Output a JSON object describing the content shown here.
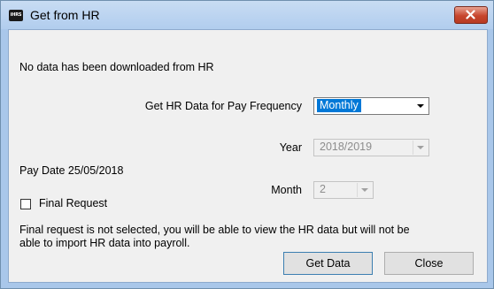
{
  "window": {
    "title": "Get from HR",
    "app_icon_text": "iHRS"
  },
  "status_message": "No data has been downloaded from HR",
  "pay_frequency": {
    "label": "Get HR Data for Pay Frequency",
    "value": "Monthly"
  },
  "year": {
    "label": "Year",
    "value": "2018/2019"
  },
  "pay_date": "Pay Date 25/05/2018",
  "month": {
    "label": "Month",
    "value": "2"
  },
  "final_request": {
    "label": "Final Request",
    "checked": false
  },
  "info_line1": "Final request is not selected, you will be able to view the HR data but will not be",
  "info_line2": "able to import HR data into payroll.",
  "buttons": {
    "get_data": "Get Data",
    "close": "Close"
  },
  "colors": {
    "selection": "#0078d7",
    "close_button": "#c7452d",
    "title_bar": "#b1cdee"
  }
}
